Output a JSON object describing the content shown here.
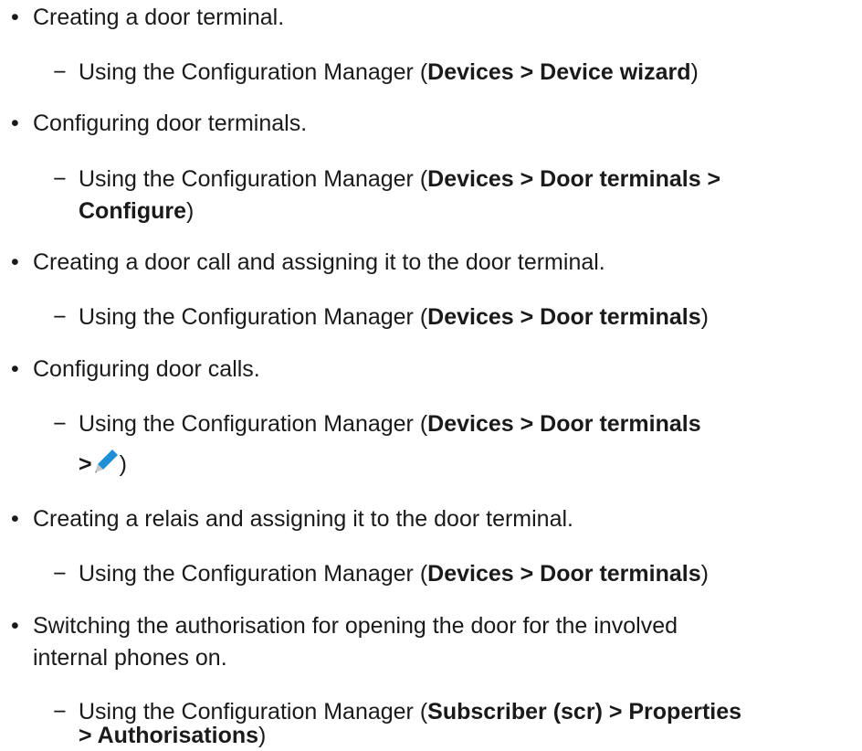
{
  "items": [
    {
      "text": "Creating a door terminal.",
      "sub": {
        "prefix": "Using the Configuration Manager (",
        "path": "Devices > Device wizard",
        "suffix": ")"
      }
    },
    {
      "text": "Configuring door terminals.",
      "sub": {
        "prefix": "Using the Configuration Manager (",
        "path_line1": "Devices > Door terminals >",
        "path_line2": "Configure",
        "suffix": ")"
      }
    },
    {
      "text": "Creating a door call and assigning it to the door terminal.",
      "sub": {
        "prefix": "Using the Configuration Manager (",
        "path": "Devices > Door terminals",
        "suffix": ")"
      }
    },
    {
      "text": "Configuring door calls.",
      "sub": {
        "prefix": "Using the Configuration Manager (",
        "path_line1": "Devices > Door terminals",
        "path_line2": ">",
        "icon": "pencil-icon",
        "suffix": ")"
      }
    },
    {
      "text": "Creating a relais and assigning it to the door terminal.",
      "sub": {
        "prefix": "Using the Configuration Manager (",
        "path": "Devices > Door terminals",
        "suffix": ")"
      }
    },
    {
      "text_line1": "Switching the authorisation for opening the door for the involved",
      "text_line2": "internal phones on.",
      "sub": {
        "prefix": "Using the Configuration Manager (",
        "path_line1": "Subscriber (scr) > Properties",
        "path_line2": "> Authorisations",
        "suffix": ")"
      }
    }
  ],
  "glyphs": {
    "bullet": "•",
    "dash": "−"
  },
  "colors": {
    "text": "#1a1a1a",
    "pencil_blue": "#1e8fd6",
    "pencil_tip": "#c8c8c8"
  }
}
